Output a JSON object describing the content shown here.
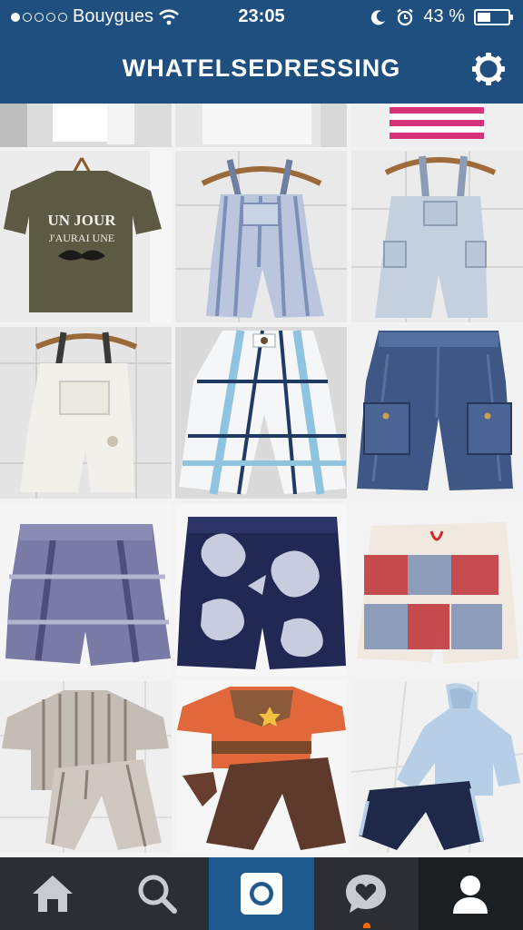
{
  "status_bar": {
    "carrier": "Bouygues",
    "time": "23:05",
    "battery_percent": "43 %",
    "battery_level": 0.43,
    "signal_dots_filled": 1,
    "signal_dots_total": 5,
    "icons": [
      "wifi-icon",
      "moon-icon",
      "alarm-icon",
      "battery-icon"
    ]
  },
  "app_bar": {
    "title": "WHATELSEDRESSING",
    "icon": "gear-icon"
  },
  "photo_grid": {
    "columns": 3,
    "items": [
      {
        "subject": "white-top-cropped"
      },
      {
        "subject": "white-shirt-cropped"
      },
      {
        "subject": "pink-striped-top-cropped"
      },
      {
        "subject": "khaki-tshirt-mustache",
        "printed_text": "UN JOUR J'AURAI UNE"
      },
      {
        "subject": "striped-overalls"
      },
      {
        "subject": "light-blue-overalls"
      },
      {
        "subject": "white-overalls"
      },
      {
        "subject": "plaid-cargo-shorts"
      },
      {
        "subject": "denim-cargo-shorts"
      },
      {
        "subject": "purple-plaid-shorts"
      },
      {
        "subject": "navy-hibiscus-swim-shorts"
      },
      {
        "subject": "red-blue-check-shorts"
      },
      {
        "subject": "striped-shirt-pants-set"
      },
      {
        "subject": "orange-cowboy-shirt-brown-pants"
      },
      {
        "subject": "light-blue-tracksuit"
      }
    ]
  },
  "tab_bar": {
    "active_tab": "camera",
    "tabs": [
      {
        "id": "home",
        "icon": "home-icon"
      },
      {
        "id": "explore",
        "icon": "search-icon"
      },
      {
        "id": "camera",
        "icon": "camera-icon"
      },
      {
        "id": "activity",
        "icon": "activity-heart-icon"
      },
      {
        "id": "profile",
        "icon": "profile-icon"
      }
    ]
  },
  "colors": {
    "header_blue": "#1f4f7e",
    "tabbar_dark": "#2b2f33",
    "tab_active_blue": "#1f5a8e",
    "notification_orange": "#ff6a00"
  }
}
